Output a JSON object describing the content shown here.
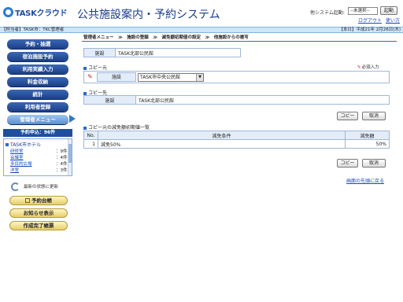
{
  "header": {
    "logo_text": "TASKクラウド",
    "title": "公共施設案内・予約システム",
    "sys_switch_label": "他システム起動:",
    "sys_select_value": "--未選択--",
    "launch_label": "起動",
    "logout_label": "ログアウト",
    "help_label": "使い方"
  },
  "status": {
    "left": "【担当者】TASK市：TKC管理者",
    "right": "【本日】平成21年 2月26日(木)"
  },
  "sidebar": {
    "nav": [
      {
        "label": "予約・抽選"
      },
      {
        "label": "宿泊施設予約"
      },
      {
        "label": "利用実績入力"
      },
      {
        "label": "料金収納"
      },
      {
        "label": "統計"
      },
      {
        "label": "利用者登録"
      },
      {
        "label": "管理者メニュー"
      }
    ],
    "resv_head": "予約申込：96件",
    "resv_facility": "TASK市ホテル",
    "resv_items": [
      {
        "name": "研修室",
        "count": "：9件"
      },
      {
        "name": "会議室",
        "count": "：4件"
      },
      {
        "name": "多目的広場",
        "count": "：4件"
      },
      {
        "name": "洋室",
        "count": "：3件"
      }
    ],
    "refresh_label": "最新の状態に更新",
    "buttons": [
      {
        "label": "予約台帳"
      },
      {
        "label": "お知らせ表示"
      },
      {
        "label": "作成完了帳票"
      }
    ]
  },
  "main": {
    "breadcrumb": "管理者メニュー　≫　施設の登録　≫　減免額初期値の設定　≫　他施設からの複写",
    "facility_label": "施設",
    "facility_value": "TASK北部公民館",
    "copy_from_title": "コピー元",
    "required_label": "必須入力",
    "copy_from_label": "施設",
    "copy_from_select": "TASK市中央公民館",
    "copy_to_title": "コピー先",
    "copy_to_label": "施設",
    "copy_to_value": "TASK北部公民館",
    "copy_button": "コピー",
    "cancel_button": "取消",
    "list_title": "コピー元の減免額初期値一覧",
    "list_headers": [
      "No.",
      "減免条件",
      "減免額"
    ],
    "list_rows": [
      {
        "no": "1",
        "condition": "減免50%",
        "amount": "50%"
      }
    ],
    "copy_button_2": "コピー",
    "cancel_button_2": "取消",
    "top_link": "画面の先頭に戻る"
  }
}
